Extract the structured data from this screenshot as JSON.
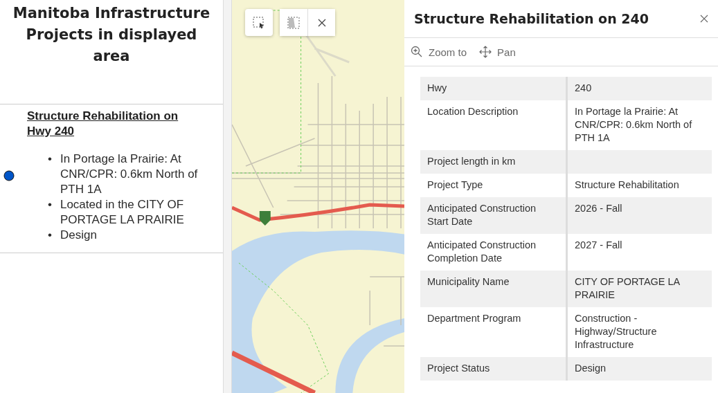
{
  "sidebar": {
    "title": "Manitoba Infrastructure Projects in displayed area",
    "items": [
      {
        "title": "Structure Rehabilitation on Hwy 240",
        "marker": "•",
        "bullets": [
          "In Portage la Prairie: At CNR/CPR: 0.6km North of PTH 1A",
          "Located in the CITY OF PORTAGE LA PRAIRIE",
          "Design"
        ]
      }
    ]
  },
  "map": {
    "kind": "picture",
    "tools": [
      {
        "kind": "select"
      },
      {
        "kind": "select-area"
      },
      {
        "kind": "clear"
      }
    ]
  },
  "popup": {
    "title": "Structure Rehabilitation on 240",
    "actions": [
      {
        "kind": "zoom",
        "label": "Zoom to"
      },
      {
        "kind": "pan",
        "label": "Pan"
      }
    ],
    "fields": [
      {
        "label": "Hwy",
        "value": "240"
      },
      {
        "label": "Location Description",
        "value": "In Portage la Prairie: At CNR/CPR: 0.6km North of PTH 1A"
      },
      {
        "label": "Project length in km"
      },
      {
        "label": "Project Type",
        "value": "Structure Rehabilitation"
      },
      {
        "label": "Anticipated Construction Start Date",
        "value": "2026 - Fall"
      },
      {
        "label": "Anticipated Construction Completion Date",
        "value": "2027 - Fall"
      },
      {
        "label": "Municipality Name",
        "value": "CITY OF PORTAGE LA PRAIRIE"
      },
      {
        "label": "Department Program",
        "value": "Construction - Highway/Structure Infrastructure"
      },
      {
        "label": "Project Status",
        "value": "Design"
      }
    ]
  }
}
